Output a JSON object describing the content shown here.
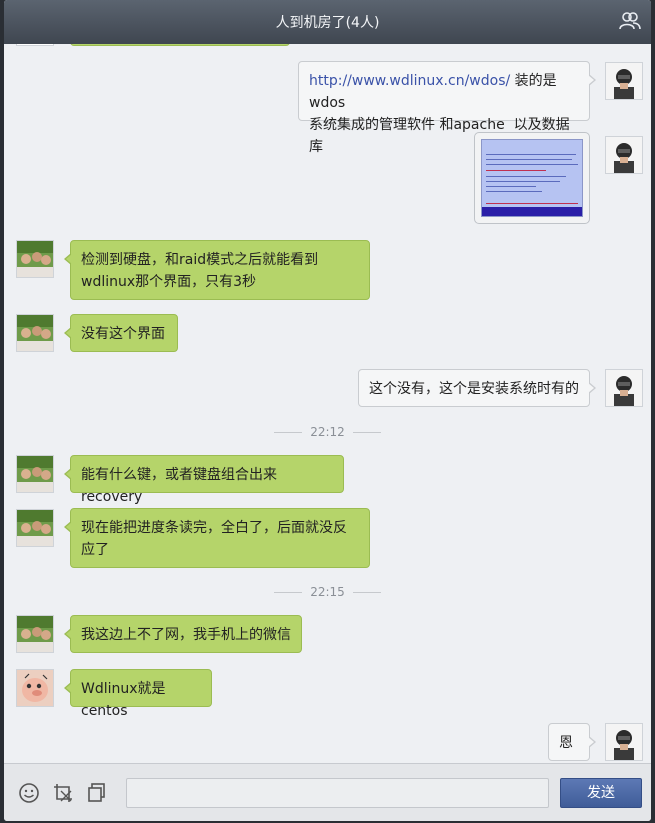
{
  "window": {
    "title": "人到机房了(4人)"
  },
  "messages": [
    {
      "side": "right",
      "link": "http://www.wdlinux.cn/wdos/",
      "text": " 装的是  wdos\n系统集成的管理软件 和apache  以及数据库"
    },
    {
      "side": "right",
      "type": "image"
    },
    {
      "side": "left",
      "text": "检测到硬盘，和raid模式之后就能看到\nwdlinux那个界面，只有3秒"
    },
    {
      "side": "left",
      "text": "没有这个界面"
    },
    {
      "side": "right",
      "text": "这个没有，这个是安装系统时有的"
    },
    {
      "type": "time",
      "text": "22:12"
    },
    {
      "side": "left",
      "text": "能有什么键，或者键盘组合出来recovery"
    },
    {
      "side": "left",
      "text": "现在能把进度条读完，全白了，后面就没反\n应了"
    },
    {
      "type": "time",
      "text": "22:15"
    },
    {
      "side": "left",
      "text": "我这边上不了网，我手机上的微信"
    },
    {
      "side": "left",
      "avatar": "cartoon",
      "text": "Wdlinux就是centos"
    },
    {
      "side": "right",
      "text": "恩"
    }
  ],
  "footer": {
    "icons": [
      "smiley-icon",
      "screenshot-icon",
      "copy-icon"
    ],
    "input_value": "",
    "send_label": "发送"
  },
  "colors": {
    "green_bubble": "#b5d46a",
    "white_bubble": "#f5f6f7",
    "send_button": "#4b67a3",
    "titlebar": "#4a525d"
  }
}
